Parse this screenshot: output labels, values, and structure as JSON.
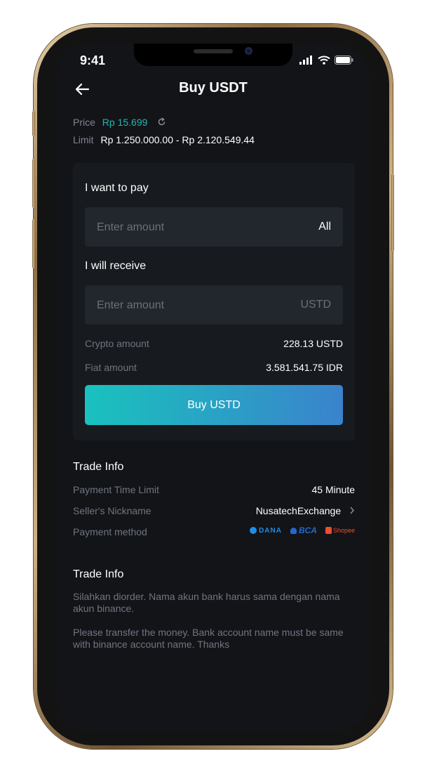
{
  "status_bar": {
    "time": "9:41"
  },
  "header": {
    "title": "Buy USDT"
  },
  "price": {
    "label": "Price",
    "value": "Rp 15.699"
  },
  "limit": {
    "label": "Limit",
    "value": "Rp 1.250.000.00 - Rp 2.120.549.44"
  },
  "pay": {
    "label": "I want to pay",
    "placeholder": "Enter amount",
    "suffix": "All"
  },
  "receive": {
    "label": "I will receive",
    "placeholder": "Enter amount",
    "suffix": "USTD"
  },
  "summary": {
    "crypto_label": "Crypto amount",
    "crypto_value": "228.13 USTD",
    "fiat_label": "Fiat amount",
    "fiat_value": "3.581.541.75 IDR"
  },
  "buy_button": {
    "label": "Buy USTD"
  },
  "trade_info": {
    "title": "Trade Info",
    "time_limit_label": "Payment Time Limit",
    "time_limit_value": "45 Minute",
    "seller_label": "Seller's Nickname",
    "seller_value": "NusatechExchange",
    "payment_label": "Payment method",
    "payment_methods": [
      {
        "name": "DANA",
        "icon": "dana-logo",
        "color": "#1f8ce6"
      },
      {
        "name": "BCA",
        "icon": "bca-logo",
        "color": "#2667c9"
      },
      {
        "name": "Shopee",
        "icon": "shopee-logo",
        "color": "#ee4d2d"
      }
    ]
  },
  "terms": {
    "title": "Trade Info",
    "paragraph_1": "Silahkan diorder. Nama akun bank harus sama dengan nama akun binance.",
    "paragraph_2": "Please transfer the money. Bank account name must be same with binance account name. Thanks"
  },
  "colors": {
    "accent": "#20b7b2",
    "background": "#121418",
    "card": "#171a1f",
    "input": "#22262d"
  }
}
